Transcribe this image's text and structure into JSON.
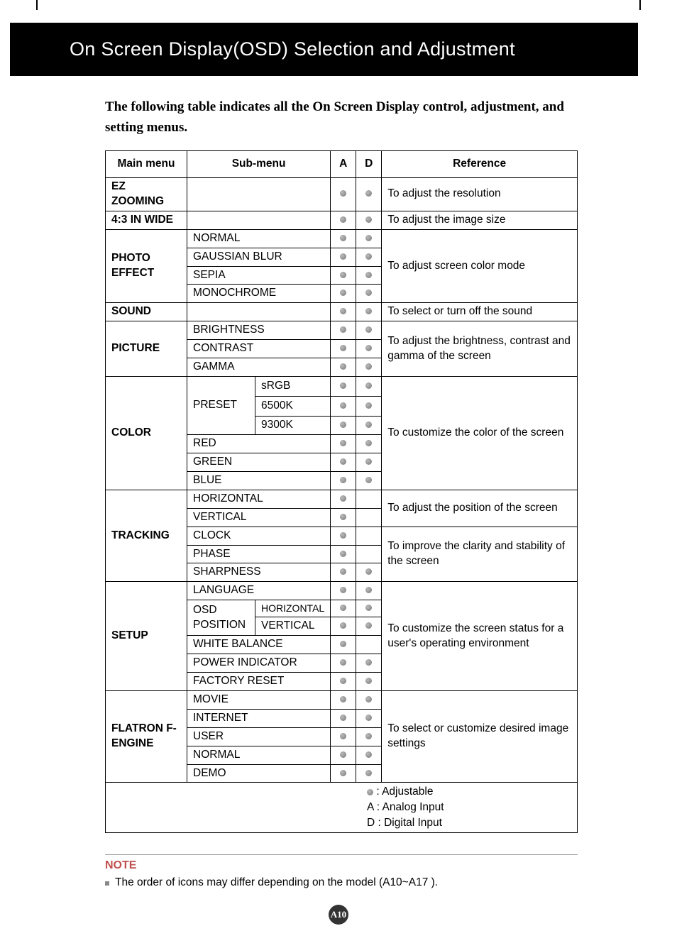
{
  "header": "On Screen Display(OSD) Selection and Adjustment",
  "intro": "The following table indicates all the On Screen Display control, adjustment, and setting menus.",
  "table": {
    "headers": {
      "main": "Main menu",
      "sub": "Sub-menu",
      "a": "A",
      "d": "D",
      "ref": "Reference"
    },
    "groups": [
      {
        "main": "EZ ZOOMING",
        "rows": [
          {
            "sub1": "",
            "sub2": "",
            "a": true,
            "d": true
          }
        ],
        "ref": "To adjust the resolution"
      },
      {
        "main": "4:3 IN WIDE",
        "rows": [
          {
            "sub1": "",
            "sub2": "",
            "a": true,
            "d": true
          }
        ],
        "ref": "To adjust the image size"
      },
      {
        "main": "PHOTO EFFECT",
        "rows": [
          {
            "sub1": "NORMAL",
            "a": true,
            "d": true
          },
          {
            "sub1": "GAUSSIAN BLUR",
            "a": true,
            "d": true
          },
          {
            "sub1": "SEPIA",
            "a": true,
            "d": true
          },
          {
            "sub1": "MONOCHROME",
            "a": true,
            "d": true
          }
        ],
        "ref": "To adjust screen color mode"
      },
      {
        "main": "SOUND",
        "rows": [
          {
            "sub1": "",
            "a": true,
            "d": true
          }
        ],
        "ref": "To select or turn off the sound"
      },
      {
        "main": "PICTURE",
        "rows": [
          {
            "sub1": "BRIGHTNESS",
            "a": true,
            "d": true
          },
          {
            "sub1": "CONTRAST",
            "a": true,
            "d": true
          },
          {
            "sub1": "GAMMA",
            "a": true,
            "d": true
          }
        ],
        "ref": "To adjust the brightness, contrast and gamma of the screen"
      },
      {
        "main": "COLOR",
        "rows": [
          {
            "sub1": "PRESET",
            "sub2": "sRGB",
            "a": true,
            "d": true,
            "preset_span": 3
          },
          {
            "sub2": "6500K",
            "a": true,
            "d": true
          },
          {
            "sub2": "9300K",
            "a": true,
            "d": true
          },
          {
            "sub1": "RED",
            "a": true,
            "d": true
          },
          {
            "sub1": "GREEN",
            "a": true,
            "d": true
          },
          {
            "sub1": "BLUE",
            "a": true,
            "d": true
          }
        ],
        "ref": "To customize the color of the screen"
      },
      {
        "main": "TRACKING",
        "rows": [
          {
            "sub1": "HORIZONTAL",
            "a": true,
            "d": false,
            "ref": "To adjust the position of the screen",
            "ref_span": 2
          },
          {
            "sub1": "VERTICAL",
            "a": true,
            "d": false
          },
          {
            "sub1": "CLOCK",
            "a": true,
            "d": false,
            "ref": "To improve the clarity and stability of the screen",
            "ref_span": 3
          },
          {
            "sub1": "PHASE",
            "a": true,
            "d": false
          },
          {
            "sub1": "SHARPNESS",
            "a": true,
            "d": true
          }
        ]
      },
      {
        "main": "SETUP",
        "rows": [
          {
            "sub1": "LANGUAGE",
            "a": true,
            "d": true
          },
          {
            "sub1": "OSD POSITION",
            "sub2": "HORIZONTAL",
            "a": true,
            "d": true,
            "osd_span": 2,
            "sub2_small": true
          },
          {
            "sub2": "VERTICAL",
            "a": true,
            "d": true
          },
          {
            "sub1": "WHITE BALANCE",
            "a": true,
            "d": false
          },
          {
            "sub1": "POWER INDICATOR",
            "a": true,
            "d": true
          },
          {
            "sub1": "FACTORY RESET",
            "a": true,
            "d": true
          }
        ],
        "ref": "To customize the screen status for a user's operating environment"
      },
      {
        "main": "FLATRON F-ENGINE",
        "rows": [
          {
            "sub1": "MOVIE",
            "a": true,
            "d": true
          },
          {
            "sub1": "INTERNET",
            "a": true,
            "d": true
          },
          {
            "sub1": "USER",
            "a": true,
            "d": true
          },
          {
            "sub1": "NORMAL",
            "a": true,
            "d": true
          },
          {
            "sub1": "DEMO",
            "a": true,
            "d": true
          }
        ],
        "ref": "To select or customize desired image settings"
      }
    ],
    "legend": {
      "adjustable": ": Adjustable",
      "a": "A : Analog Input",
      "d": "D : Digital Input"
    }
  },
  "note": {
    "title": "NOTE",
    "item": "The order of icons may differ depending on the model (A10~A17 )."
  },
  "page_number": "A10"
}
